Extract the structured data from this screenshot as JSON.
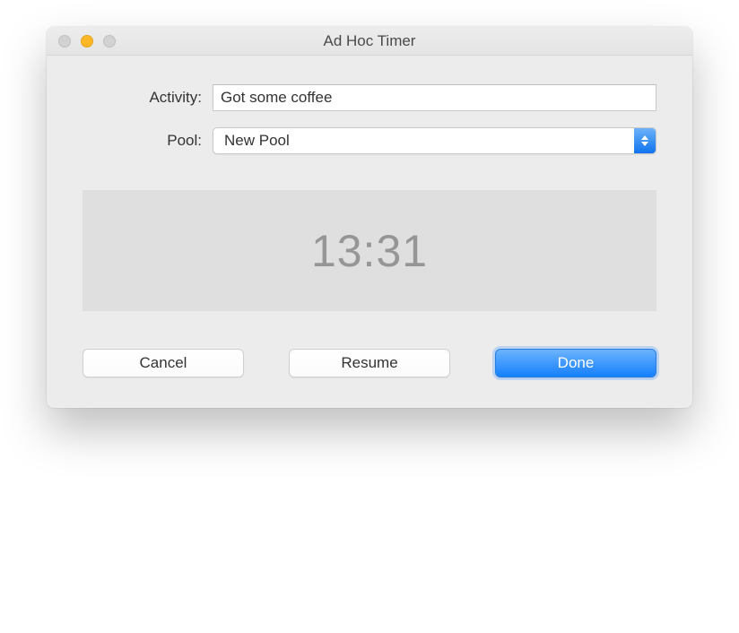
{
  "window": {
    "title": "Ad Hoc Timer"
  },
  "form": {
    "activity_label": "Activity:",
    "activity_value": "Got some coffee",
    "pool_label": "Pool:",
    "pool_value": "New Pool"
  },
  "timer": {
    "display": "13:31"
  },
  "buttons": {
    "cancel": "Cancel",
    "resume": "Resume",
    "done": "Done"
  }
}
